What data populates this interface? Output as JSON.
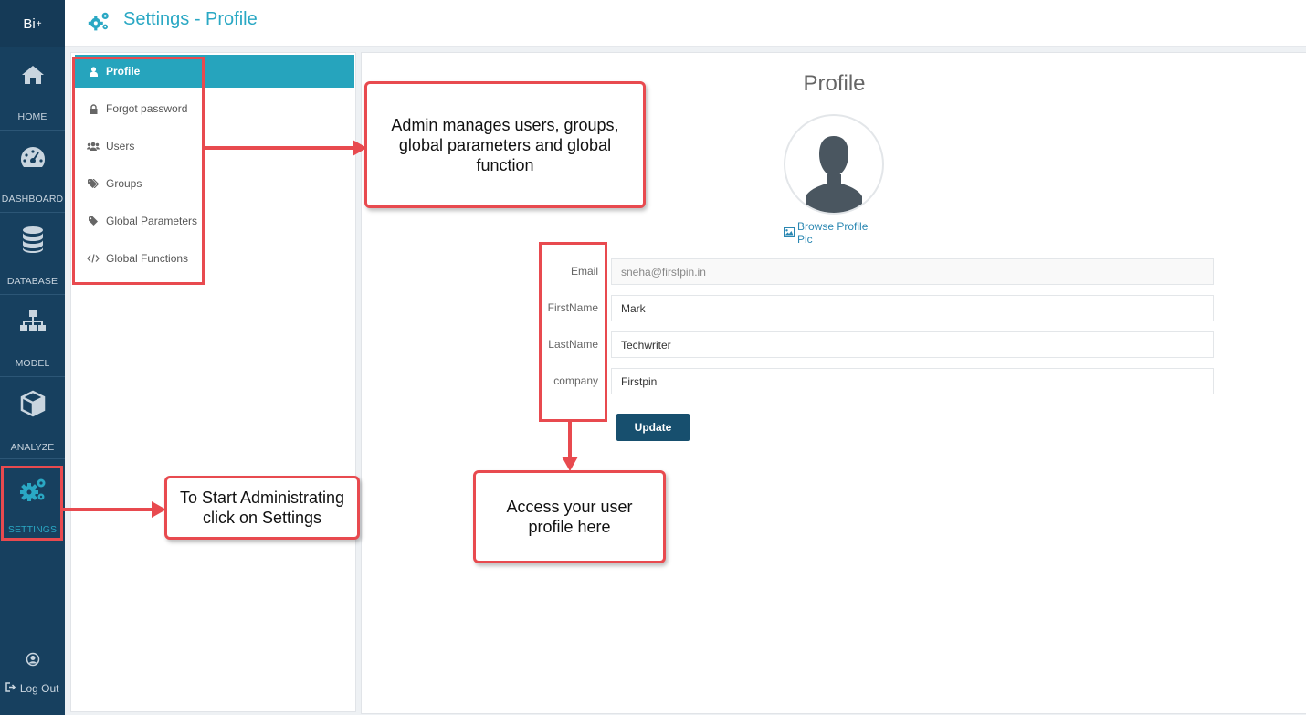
{
  "app": {
    "brand": "Bi",
    "brand_sup": "+"
  },
  "nav": {
    "items": [
      {
        "label": "HOME",
        "icon": "home-icon"
      },
      {
        "label": "DASHBOARD",
        "icon": "dashboard-icon"
      },
      {
        "label": "DATABASE",
        "icon": "database-icon"
      },
      {
        "label": "MODEL",
        "icon": "sitemap-icon"
      },
      {
        "label": "ANALYZE",
        "icon": "cube-icon"
      },
      {
        "label": "SETTINGS",
        "icon": "gears-icon",
        "active": true
      }
    ],
    "logout": "Log Out"
  },
  "header": {
    "title": "Settings - Profile"
  },
  "settings_menu": {
    "items": [
      {
        "label": "Profile",
        "icon": "user-icon",
        "active": true
      },
      {
        "label": "Forgot password",
        "icon": "lock-icon"
      },
      {
        "label": "Users",
        "icon": "users-icon"
      },
      {
        "label": "Groups",
        "icon": "tags-icon"
      },
      {
        "label": "Global Parameters",
        "icon": "tag-icon"
      },
      {
        "label": "Global Functions",
        "icon": "code-icon"
      }
    ]
  },
  "profile": {
    "title": "Profile",
    "browse_label": "Browse Profile Pic",
    "fields": [
      {
        "label": "Email",
        "value": "sneha@firstpin.in",
        "disabled": true
      },
      {
        "label": "FirstName",
        "value": "Mark"
      },
      {
        "label": "LastName",
        "value": "Techwriter"
      },
      {
        "label": "company",
        "value": "Firstpin"
      }
    ],
    "update_label": "Update"
  },
  "annotations": {
    "admin_note": "Admin  manages users, groups, global parameters and global function",
    "settings_note": "To Start Administrating click on Settings",
    "profile_note": "Access your user profile here"
  },
  "colors": {
    "nav_bg": "#17405f",
    "accent": "#2aa8c4",
    "active_menu": "#26a4bd",
    "button": "#174f6e",
    "annotation_red": "#e84a4f"
  }
}
